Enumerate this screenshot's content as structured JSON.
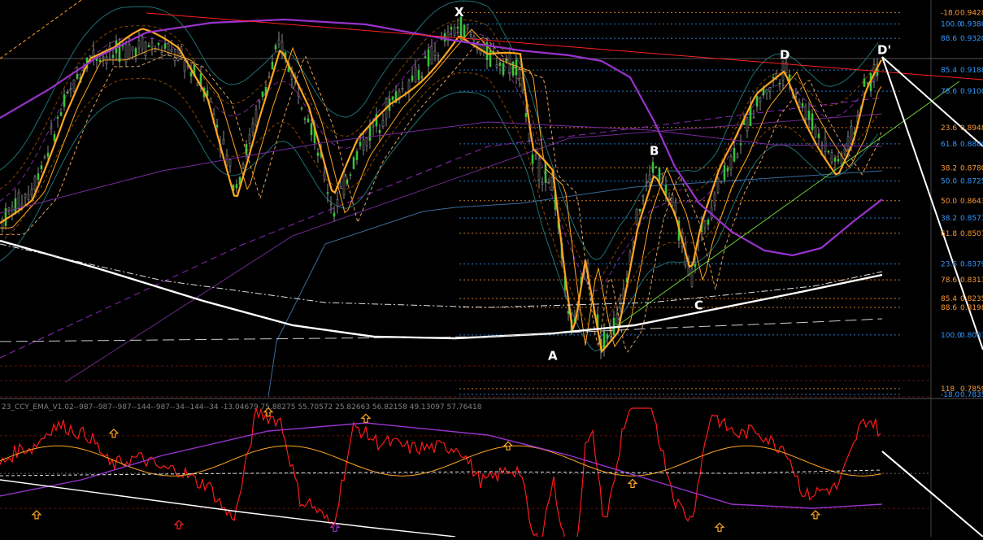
{
  "chart_data": {
    "type": "line",
    "title": "",
    "xlabel": "",
    "ylabel": "",
    "ylim": [
      0.7835,
      0.947
    ],
    "grid": false,
    "colors": {
      "background": "#000000",
      "candle": "#3ac23a",
      "price_line": "#8a8a8a",
      "ma_orange": "#ffa520",
      "ma_purple": "#9933cc",
      "trend_red": "#ff2020",
      "trend_green": "#66cc33",
      "white_curve": "#ffffff",
      "fib_orange": "#ff9933",
      "fib_blue": "#3399ff",
      "cci": "#ff1a1a"
    },
    "pattern_points": [
      {
        "label": "X",
        "x": 565,
        "y": 0.9378
      },
      {
        "label": "A",
        "x": 680,
        "y": 0.804
      },
      {
        "label": "B",
        "x": 805,
        "y": 0.88
      },
      {
        "label": "C",
        "x": 860,
        "y": 0.825
      },
      {
        "label": "D",
        "x": 965,
        "y": 0.92
      },
      {
        "label": "D'",
        "x": 1085,
        "y": 0.922
      }
    ],
    "fib_levels": [
      {
        "text": "-18.0",
        "price": "0.9428",
        "value": 0.9428,
        "color": "#ff9933"
      },
      {
        "text": "100.0",
        "price": "0.9380",
        "value": 0.938,
        "color": "#3399ff"
      },
      {
        "text": "88.6",
        "price": "0.9320",
        "value": 0.932,
        "color": "#3399ff"
      },
      {
        "text": "85.4",
        "price": "0.9188",
        "value": 0.9188,
        "color": "#3399ff"
      },
      {
        "text": "78.6",
        "price": "0.9100",
        "value": 0.91,
        "color": "#3399ff"
      },
      {
        "text": "23.6",
        "price": "0.8948",
        "value": 0.8948,
        "color": "#ff9933"
      },
      {
        "text": "61.8",
        "price": "0.8880",
        "value": 0.888,
        "color": "#3399ff"
      },
      {
        "text": "38.2",
        "price": "0.8780",
        "value": 0.878,
        "color": "#ff9933"
      },
      {
        "text": "50.0",
        "price": "0.8725",
        "value": 0.8725,
        "color": "#3399ff"
      },
      {
        "text": "50.0",
        "price": "0.8643",
        "value": 0.8643,
        "color": "#ff9933"
      },
      {
        "text": "38.2",
        "price": "0.8571",
        "value": 0.8571,
        "color": "#3399ff"
      },
      {
        "text": "61.8",
        "price": "0.8507",
        "value": 0.8507,
        "color": "#ff9933"
      },
      {
        "text": "23.6",
        "price": "0.8379",
        "value": 0.8379,
        "color": "#3399ff"
      },
      {
        "text": "78.6",
        "price": "0.8313",
        "value": 0.8313,
        "color": "#ff9933"
      },
      {
        "text": "85.4",
        "price": "0.8235",
        "value": 0.8235,
        "color": "#ff9933"
      },
      {
        "text": "88.6",
        "price": "0.8198",
        "value": 0.8198,
        "color": "#ff9933"
      },
      {
        "text": "100.0",
        "price": "0.8083",
        "value": 0.8083,
        "color": "#3399ff"
      },
      {
        "text": "118",
        "price": "0.7859",
        "value": 0.7859,
        "color": "#ff9933"
      },
      {
        "text": "-18.0",
        "price": "0.7835",
        "value": 0.7835,
        "color": "#3399ff"
      }
    ],
    "indicator": {
      "caption": "23_CCY_EMA_V1.02--987--987--987--144--987--34--144--34 -13.04679 75.88275 55.70572 25.82663 56.82158 49.13097 57.76418",
      "arrows": [
        {
          "x": 45,
          "dir": "up",
          "color": "#ffa520",
          "level": 0.15
        },
        {
          "x": 140,
          "dir": "up",
          "color": "#ffa520",
          "level": 0.8
        },
        {
          "x": 220,
          "dir": "up",
          "color": "#ff2020",
          "level": 0.07
        },
        {
          "x": 330,
          "dir": "up",
          "color": "#ffa520",
          "level": 0.97
        },
        {
          "x": 412,
          "dir": "up",
          "color": "#9933cc",
          "level": 0.05
        },
        {
          "x": 450,
          "dir": "up",
          "color": "#ffa520",
          "level": 0.92
        },
        {
          "x": 625,
          "dir": "up",
          "color": "#ffa520",
          "level": 0.7
        },
        {
          "x": 778,
          "dir": "up",
          "color": "#ffa520",
          "level": 0.4
        },
        {
          "x": 885,
          "dir": "up",
          "color": "#ffa520",
          "level": 0.05
        },
        {
          "x": 1003,
          "dir": "up",
          "color": "#ffa520",
          "level": 0.15
        }
      ]
    }
  }
}
